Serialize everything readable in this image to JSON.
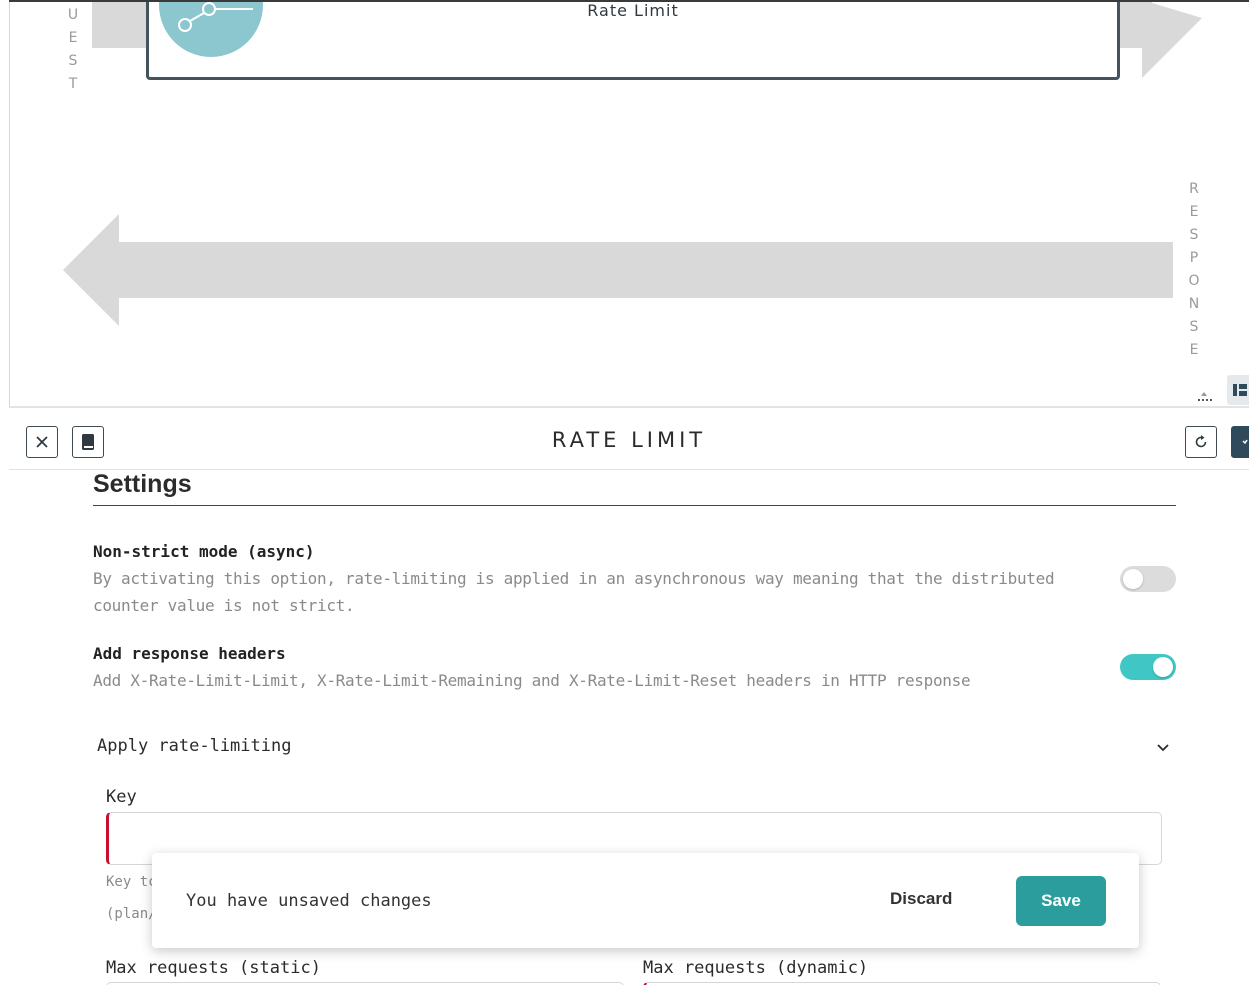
{
  "canvas": {
    "request_letters": [
      "U",
      "E",
      "S",
      "T"
    ],
    "response_letters": [
      "R",
      "E",
      "S",
      "P",
      "O",
      "N",
      "S",
      "E"
    ],
    "policy_card_title": "Rate Limit",
    "resize_handle_glyph": "⁞"
  },
  "panel": {
    "title": "RATE LIMIT",
    "close_icon": "close-icon",
    "docs_icon": "book-icon",
    "reset_icon": "reset-icon"
  },
  "settings": {
    "heading": "Settings",
    "non_strict": {
      "title": "Non-strict mode (async)",
      "description": "By activating this option, rate-limiting is applied in an asynchronous way meaning that the distributed counter value is not strict.",
      "enabled": false
    },
    "response_headers": {
      "title": "Add response headers",
      "description": "Add X-Rate-Limit-Limit, X-Rate-Limit-Remaining and X-Rate-Limit-Reset headers in HTTP response",
      "enabled": true
    },
    "apply_section": "Apply rate-limiting",
    "key_label": "Key",
    "key_value": "",
    "key_hint_1": "Key tc",
    "key_hint_2": "(plan/",
    "max_static_label": "Max requests (static)",
    "max_dynamic_label": "Max requests (dynamic)"
  },
  "toast": {
    "message": "You have unsaved changes",
    "discard_label": "Discard",
    "save_label": "Save"
  },
  "colors": {
    "accent": "#2a9d9c",
    "toggle_on": "#40c7c5",
    "error": "#c8102e",
    "header_dark": "#2f4a5a"
  }
}
